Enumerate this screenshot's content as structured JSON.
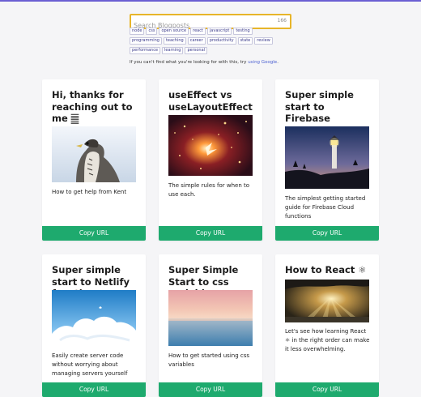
{
  "search": {
    "placeholder": "Search Blogposts",
    "count": "166"
  },
  "tags": [
    "node",
    "css",
    "open source",
    "react",
    "javascript",
    "testing",
    "programming",
    "teaching",
    "career",
    "productivity",
    "state",
    "review",
    "performance",
    "learning",
    "personal"
  ],
  "hint": {
    "text": "If you can't find what you're looking for with this, try",
    "link": "using Google",
    "suffix": "."
  },
  "cards": [
    {
      "title": "Hi, thanks for reaching out to me",
      "title_suffix": "𝄛",
      "desc": "How to get help from Kent",
      "button": "Copy URL",
      "image": "falcon"
    },
    {
      "title": "useEffect vs useLayoutEffect",
      "desc": "The simple rules for when to use each.",
      "button": "Copy URL",
      "image": "sparks"
    },
    {
      "title": "Super simple start to Firebase functions",
      "desc": "The simplest getting started guide for Firebase Cloud functions",
      "button": "Copy URL",
      "image": "lighthouse"
    },
    {
      "title": "Super simple start to Netlify functions",
      "desc": "Easily create server code without worrying about managing servers yourself",
      "button": "Copy URL",
      "image": "clouds"
    },
    {
      "title": "Super Simple Start to css variables",
      "desc": "How to get started using css variables",
      "button": "Copy URL",
      "image": "sunset-sea"
    },
    {
      "title": "How to React ⚛",
      "desc": "Let's see how learning React ⚛ in the right order can make it less overwhelming.",
      "button": "Copy URL",
      "image": "sunbeams"
    }
  ],
  "colors": {
    "accent": "#1eaa6e",
    "search_border": "#e7b52a",
    "link": "#4b5fd1",
    "top_line": "#6b5fd3"
  }
}
